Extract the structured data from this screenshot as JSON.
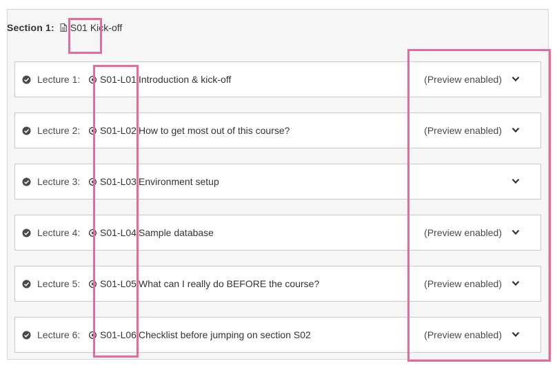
{
  "section": {
    "label": "Section 1:",
    "code": "S01",
    "title": "Kick-off"
  },
  "lectures": [
    {
      "label": "Lecture 1:",
      "code": "S01-L01",
      "title": "Introduction & kick-off",
      "preview": "(Preview enabled)"
    },
    {
      "label": "Lecture 2:",
      "code": "S01-L02",
      "title": "How to get most out of this course?",
      "preview": "(Preview enabled)"
    },
    {
      "label": "Lecture 3:",
      "code": "S01-L03",
      "title": "Environment setup",
      "preview": ""
    },
    {
      "label": "Lecture 4:",
      "code": "S01-L04",
      "title": "Sample database",
      "preview": "(Preview enabled)"
    },
    {
      "label": "Lecture 5:",
      "code": "S01-L05",
      "title": "What can I really do BEFORE the course?",
      "preview": "(Preview enabled)"
    },
    {
      "label": "Lecture 6:",
      "code": "S01-L06",
      "title": "Checklist before jumping on section S02",
      "preview": "(Preview enabled)"
    }
  ],
  "icons": {
    "document": "document-icon",
    "check": "check-circle-icon",
    "play": "play-circle-icon",
    "chevron": "chevron-down-icon"
  },
  "colors": {
    "highlight": "#e8699a",
    "panel_background": "#f6f6f6",
    "row_border": "#c9c9c9",
    "text": "#333333"
  }
}
